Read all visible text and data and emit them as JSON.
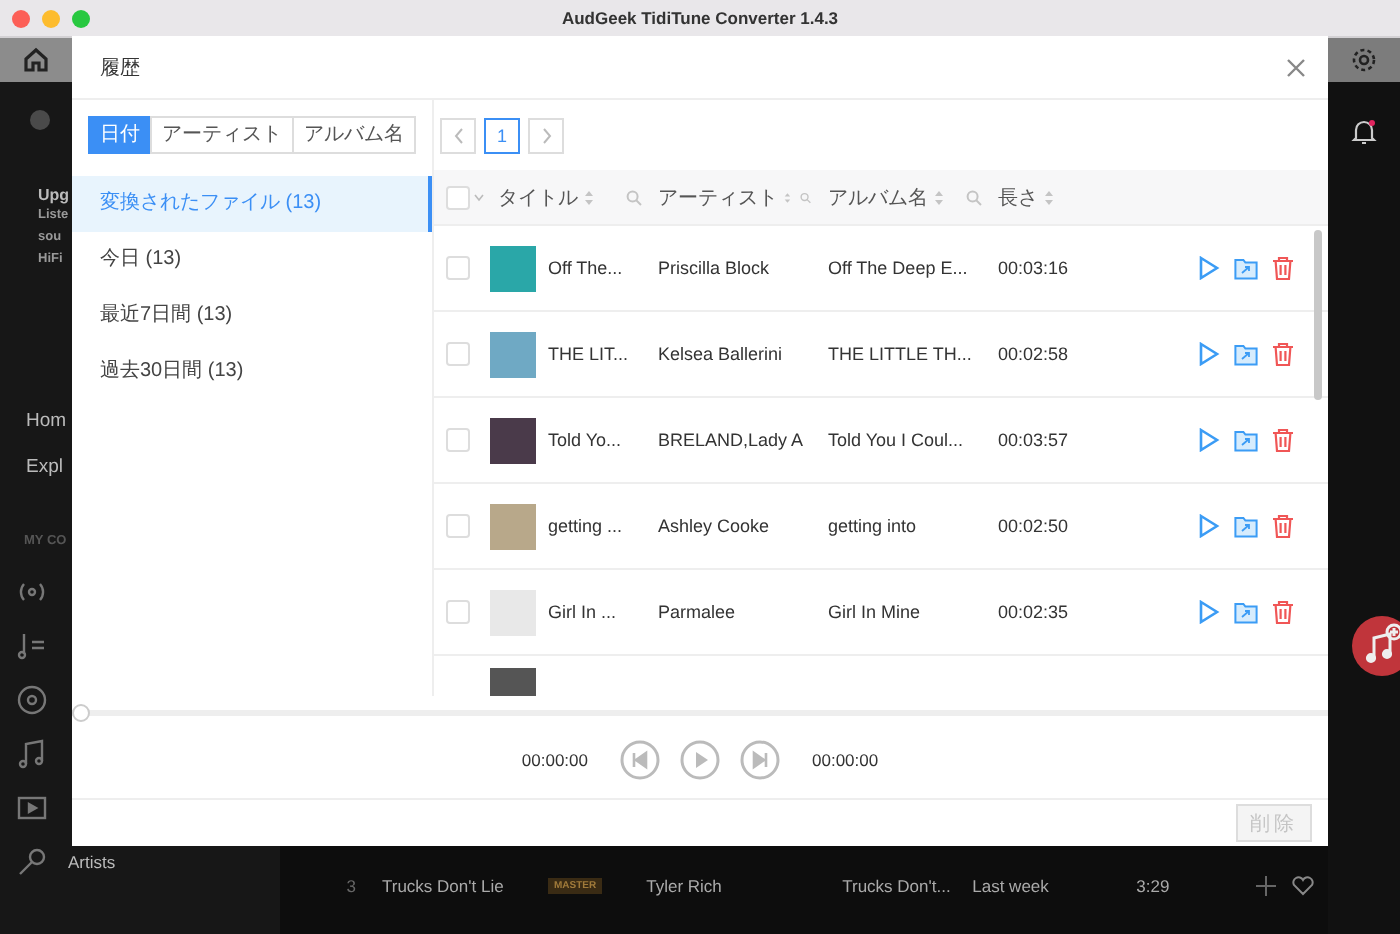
{
  "window": {
    "title": "AudGeek TidiTune Converter 1.4.3"
  },
  "background_app": {
    "sidebar_fragments": [
      {
        "kind": "heading",
        "text": "Upg"
      },
      {
        "kind": "small",
        "text": "Liste"
      },
      {
        "kind": "small",
        "text": "sou"
      },
      {
        "kind": "small",
        "text": "HiFi"
      },
      {
        "kind": "nav",
        "text": "Hom"
      },
      {
        "kind": "nav",
        "text": "Expl"
      },
      {
        "kind": "section",
        "text": "MY CO"
      }
    ],
    "sidebar_bottom_item": "Artists",
    "track_row": {
      "number": "3",
      "title": "Trucks Don't Lie",
      "badge": "MASTER",
      "artist": "Tyler Rich",
      "album": "Trucks Don't...",
      "added": "Last week",
      "duration": "3:29"
    }
  },
  "dialog": {
    "title": "履歴",
    "filter_tabs": [
      {
        "label": "日付",
        "selected": true
      },
      {
        "label": "アーティスト",
        "selected": false
      },
      {
        "label": "アルバム名",
        "selected": false
      }
    ],
    "groups": [
      {
        "label": "変換されたファイル (13)",
        "selected": true
      },
      {
        "label": "今日 (13)",
        "selected": false
      },
      {
        "label": "最近7日間 (13)",
        "selected": false
      },
      {
        "label": "過去30日間 (13)",
        "selected": false
      }
    ],
    "pagination": {
      "pages": [
        {
          "label": "1",
          "selected": true
        }
      ]
    },
    "table": {
      "columns": [
        {
          "label": "タイトル",
          "search": true
        },
        {
          "label": "アーティスト",
          "search": true
        },
        {
          "label": "アルバム名",
          "search": true
        },
        {
          "label": "長さ",
          "search": false
        }
      ],
      "select_all_checked": false,
      "rows": [
        {
          "title": "Off The...",
          "artist": "Priscilla Block",
          "album": "Off The Deep E...",
          "duration": "00:03:16",
          "checked": false,
          "color": "#2aa7a8"
        },
        {
          "title": "THE LIT...",
          "artist": "Kelsea Ballerini",
          "album": "THE LITTLE TH...",
          "duration": "00:02:58",
          "checked": false,
          "color": "#6fa9c4"
        },
        {
          "title": "Told Yo...",
          "artist": "BRELAND,Lady A",
          "album": "Told You I Coul...",
          "duration": "00:03:57",
          "checked": false,
          "color": "#4a3a4a"
        },
        {
          "title": "getting ...",
          "artist": "Ashley Cooke",
          "album": "getting into",
          "duration": "00:02:50",
          "checked": false,
          "color": "#b8a88a"
        },
        {
          "title": "Girl In ...",
          "artist": "Parmalee",
          "album": "Girl In Mine",
          "duration": "00:02:35",
          "checked": false,
          "color": "#e8e8e8"
        }
      ]
    },
    "player": {
      "level": 0,
      "elapsed": "00:00:00",
      "total": "00:00:00"
    },
    "delete_button": {
      "label": "削除",
      "disabled": true
    }
  }
}
